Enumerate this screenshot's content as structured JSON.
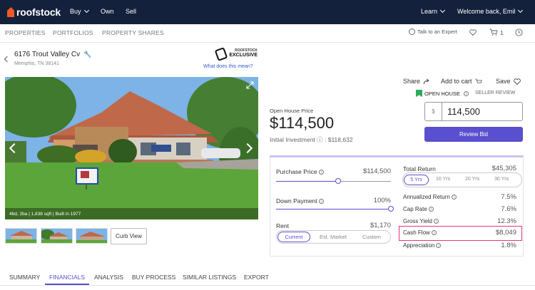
{
  "topbar": {
    "brand": "roofstock",
    "nav": [
      {
        "label": "Buy"
      },
      {
        "label": "Own"
      },
      {
        "label": "Sell"
      }
    ],
    "learn": "Learn",
    "welcome": "Welcome back, Emil"
  },
  "subnav": {
    "items": [
      "PROPERTIES",
      "PORTFOLIOS",
      "PROPERTY SHARES"
    ],
    "talk": "Talk to an Expert",
    "cart_count": "1"
  },
  "property": {
    "address": "6176 Trout Valley Cv",
    "city": "Memphis, TN 38141",
    "badge_small": "ROOFSTOCK",
    "badge_big": "EXCLUSIVE",
    "badge_link": "What does this mean?",
    "photo_caption": "4bd, 2ba | 1,838 sqft | Built in 1977",
    "curb_view": "Curb View"
  },
  "actions": {
    "share": "Share",
    "add_to_cart": "Add to cart",
    "save": "Save",
    "open_house": "OPEN HOUSE",
    "seller_review": "SELLER REVIEW",
    "currency_symbol": "$",
    "bid_value": "114,500",
    "review_bid": "Review Bid"
  },
  "pricing": {
    "open_house_price_label": "Open House Price",
    "price": "$114,500",
    "initial_investment": "Initial Investment ⓘ : $118,632"
  },
  "financials": {
    "purchase_price_label": "Purchase Price",
    "purchase_price": "$114,500",
    "purchase_price_level": 0.54,
    "down_payment_label": "Down Payment",
    "down_payment": "100%",
    "down_payment_level": 1.0,
    "rent_label": "Rent",
    "rent": "$1,170",
    "rent_options": [
      "Current",
      "Est. Market",
      "Custom"
    ],
    "total_return_label": "Total Return",
    "total_return": "$45,305",
    "year_options": [
      "5 Yrs",
      "10 Yrs",
      "20 Yrs",
      "30 Yrs"
    ],
    "metrics": [
      {
        "label": "Annualized Return",
        "value": "7.5%"
      },
      {
        "label": "Cap Rate",
        "value": "7.6%"
      },
      {
        "label": "Gross Yield",
        "value": "12.3%"
      },
      {
        "label": "Cash Flow",
        "value": "$8,049"
      },
      {
        "label": "Appreciation",
        "value": "1.8%"
      }
    ]
  },
  "tabs": [
    "SUMMARY",
    "FINANCIALS",
    "ANALYSIS",
    "BUY PROCESS",
    "SIMILAR LISTINGS",
    "EXPORT"
  ],
  "colors": {
    "navbar": "#14213d",
    "accent": "#5a4fcf",
    "brand_orange": "#f15a22",
    "highlight": "#e6347f",
    "open_house_green": "#2eaa5c"
  }
}
